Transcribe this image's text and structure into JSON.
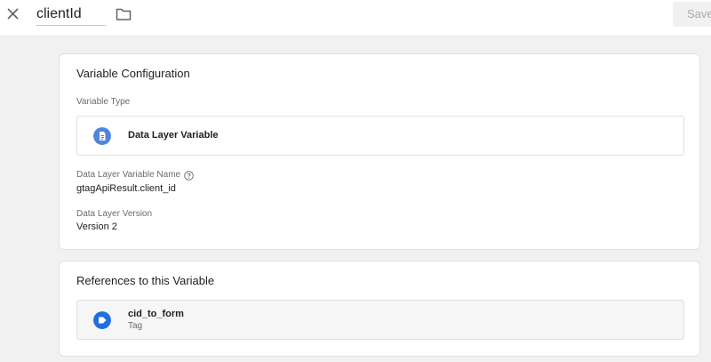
{
  "header": {
    "variable_name": "clientId",
    "save_label": "Save",
    "icons": {
      "close": "close-icon",
      "folder": "folder-icon"
    }
  },
  "config": {
    "title": "Variable Configuration",
    "type_label": "Variable Type",
    "type_value": "Data Layer Variable",
    "type_icon": "document-icon",
    "name_label": "Data Layer Variable Name",
    "name_value": "gtagApiResult.client_id",
    "version_label": "Data Layer Version",
    "version_value": "Version 2"
  },
  "references": {
    "title": "References to this Variable",
    "items": [
      {
        "name": "cid_to_form",
        "kind": "Tag",
        "icon": "tag-icon"
      }
    ]
  },
  "colors": {
    "accent": "#1a73e8",
    "ref_icon": "#1f6fe0",
    "type_icon": "#4f85de"
  }
}
